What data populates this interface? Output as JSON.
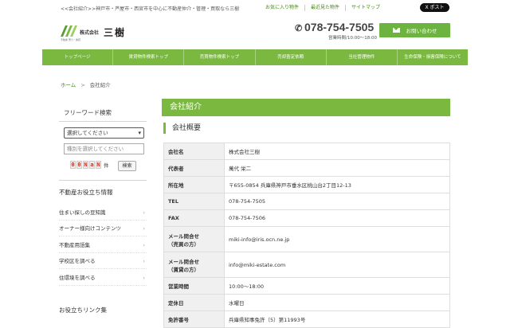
{
  "header": {
    "tagline": "<<会社紹介>>神戸市・芦屋市・西宮市を中心に不動産仲介・管理・買取なら三樹",
    "links": [
      "お気に入り物件",
      "最近見た物件",
      "サイトマップ"
    ],
    "xpost": "X ポスト",
    "logo_company_type": "株式会社",
    "logo_name": "三樹",
    "logo_sub": "不動産 売り・賃貸",
    "phone": "078-754-7505",
    "hours": "営業時間/10:00〜18:00",
    "contact_label": "お問い合わせ"
  },
  "nav": [
    "トップページ",
    "賃貸物件検索トップ",
    "売買物件検索トップ",
    "売却査定依頼",
    "当社管理物件",
    "生命保険・損害保険について"
  ],
  "breadcrumb": {
    "home": "ホーム",
    "sep": ">",
    "current": "会社紹介"
  },
  "sidebar": {
    "search_title": "フリーワード検索",
    "select_value": "選択してください",
    "input_placeholder": "種別を選択してください",
    "count_digits": [
      "0",
      "0",
      "N",
      "a",
      "N"
    ],
    "count_unit": "件",
    "search_button": "検索",
    "info_title": "不動産お役立ち情報",
    "info_links": [
      "住まい探しの豆知識",
      "オーナー様向けコンテンツ",
      "不動産用語集",
      "学校区を調べる",
      "住環境を調べる"
    ],
    "link_title": "お役立ちリンク集"
  },
  "main": {
    "title": "会社紹介",
    "section": "会社概要",
    "rows": [
      {
        "k": "会社名",
        "v": "株式会社三樹"
      },
      {
        "k": "代表者",
        "v": "萬代 栄二"
      },
      {
        "k": "所在地",
        "v": "〒655-0854 兵庫県神戸市垂水区桃山台2丁目12-13"
      },
      {
        "k": "TEL",
        "v": "078-754-7505"
      },
      {
        "k": "FAX",
        "v": "078-754-7506"
      },
      {
        "k": "メール問合せ\n（売買の方）",
        "v": "miki-info@iris.ocn.ne.jp"
      },
      {
        "k": "メール問合せ\n（賃貸の方）",
        "v": "info@miki-estate.com"
      },
      {
        "k": "営業時間",
        "v": "10:00〜18:00"
      },
      {
        "k": "定休日",
        "v": "水曜日"
      },
      {
        "k": "免許番号",
        "v": "兵庫県知事免許（5）第11993号"
      }
    ]
  },
  "colors": {
    "accent": "#7ab840",
    "link": "#4a8a1c"
  }
}
